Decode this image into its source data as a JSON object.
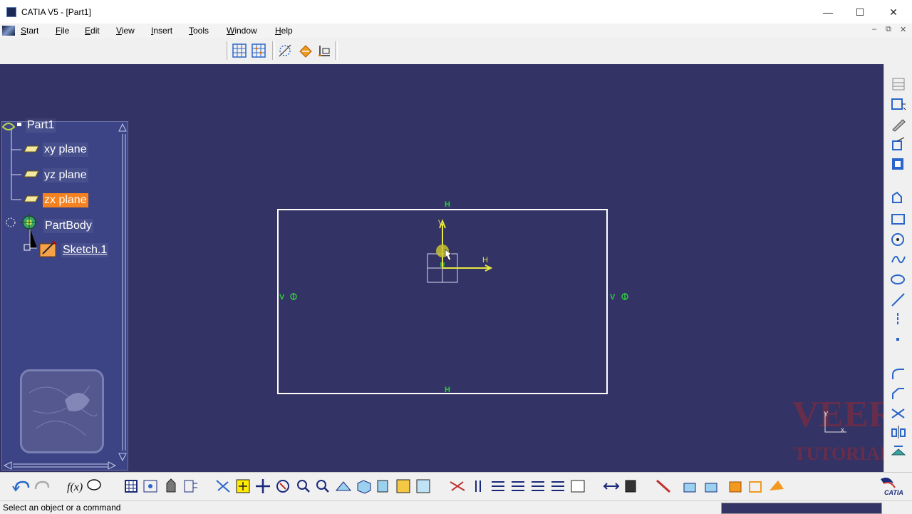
{
  "window": {
    "title": "CATIA V5 - [Part1]",
    "minimize_glyph": "—",
    "maximize_glyph": "☐",
    "close_glyph": "✕",
    "mdi_minimize": "–",
    "mdi_restore": "⧉",
    "mdi_close": "✕"
  },
  "menu": {
    "start": "tart",
    "file": "ile",
    "edit": "dit",
    "view": "iew",
    "insert": "nsert",
    "tools": "ools",
    "window": "indow",
    "help": "elp",
    "mnemonics": {
      "start": "S",
      "file": "F",
      "edit": "E",
      "view": "V",
      "insert": "I",
      "tools": "T",
      "window": "W",
      "help": "H"
    }
  },
  "tree": {
    "root": "Part1",
    "items": [
      {
        "label": "xy plane",
        "selected": false
      },
      {
        "label": "yz plane",
        "selected": false
      },
      {
        "label": "zx plane",
        "selected": true
      },
      {
        "label": "PartBody",
        "selected": false
      },
      {
        "label": "Sketch.1",
        "selected": false
      }
    ]
  },
  "sketch": {
    "constraint_h": "H",
    "constraint_v": "V",
    "axis_h": "H",
    "axis_v": "V"
  },
  "compass_axes": {
    "y": "Y",
    "x": "x"
  },
  "watermark": {
    "line1": "VEER",
    "line2": "TUTORIAL"
  },
  "brand": "CATIA",
  "status": {
    "text": "Select an object or a command"
  },
  "colors": {
    "viewport": "#333366",
    "tree_selected": "#f58220",
    "sketch_axis": "#e8e840",
    "constraint": "#2dcc3d"
  },
  "icons": {
    "top": [
      "grid-icon",
      "snap-grid-icon",
      "construction-element-icon",
      "geometrical-constraints-icon",
      "dimensional-constraints-icon"
    ],
    "right": [
      "profile-icon",
      "rectangle-icon",
      "circle-icon",
      "spline-icon",
      "ellipse-icon",
      "line-icon",
      "axis-icon",
      "point-icon",
      "corner-icon",
      "chamfer-icon",
      "trim-icon",
      "mirror-icon",
      "project-3d-icon"
    ],
    "bottom": [
      "undo-icon",
      "redo-icon",
      "formula-icon",
      "comment-icon",
      "grid-table-icon",
      "measure-icon",
      "material-icon",
      "analysis-icon",
      "fly-mode-icon",
      "fit-all-icon",
      "pan-icon",
      "rotate-icon",
      "zoom-in-icon",
      "zoom-out-icon",
      "normal-view-icon",
      "iso-view-icon",
      "shading-icon",
      "hide-show-icon",
      "swap-visible-icon",
      "sketch-analysis-icon",
      "constraint-icon",
      "view-list-icon",
      "exit-workbench-icon",
      "dimension-icon",
      "anchor-icon",
      "cut-part-icon",
      "sketch-solving-icon",
      "visualization-icon",
      "3d-grid-icon",
      "output-feature-icon",
      "profile-feature-icon",
      "catia-logo-icon"
    ]
  }
}
